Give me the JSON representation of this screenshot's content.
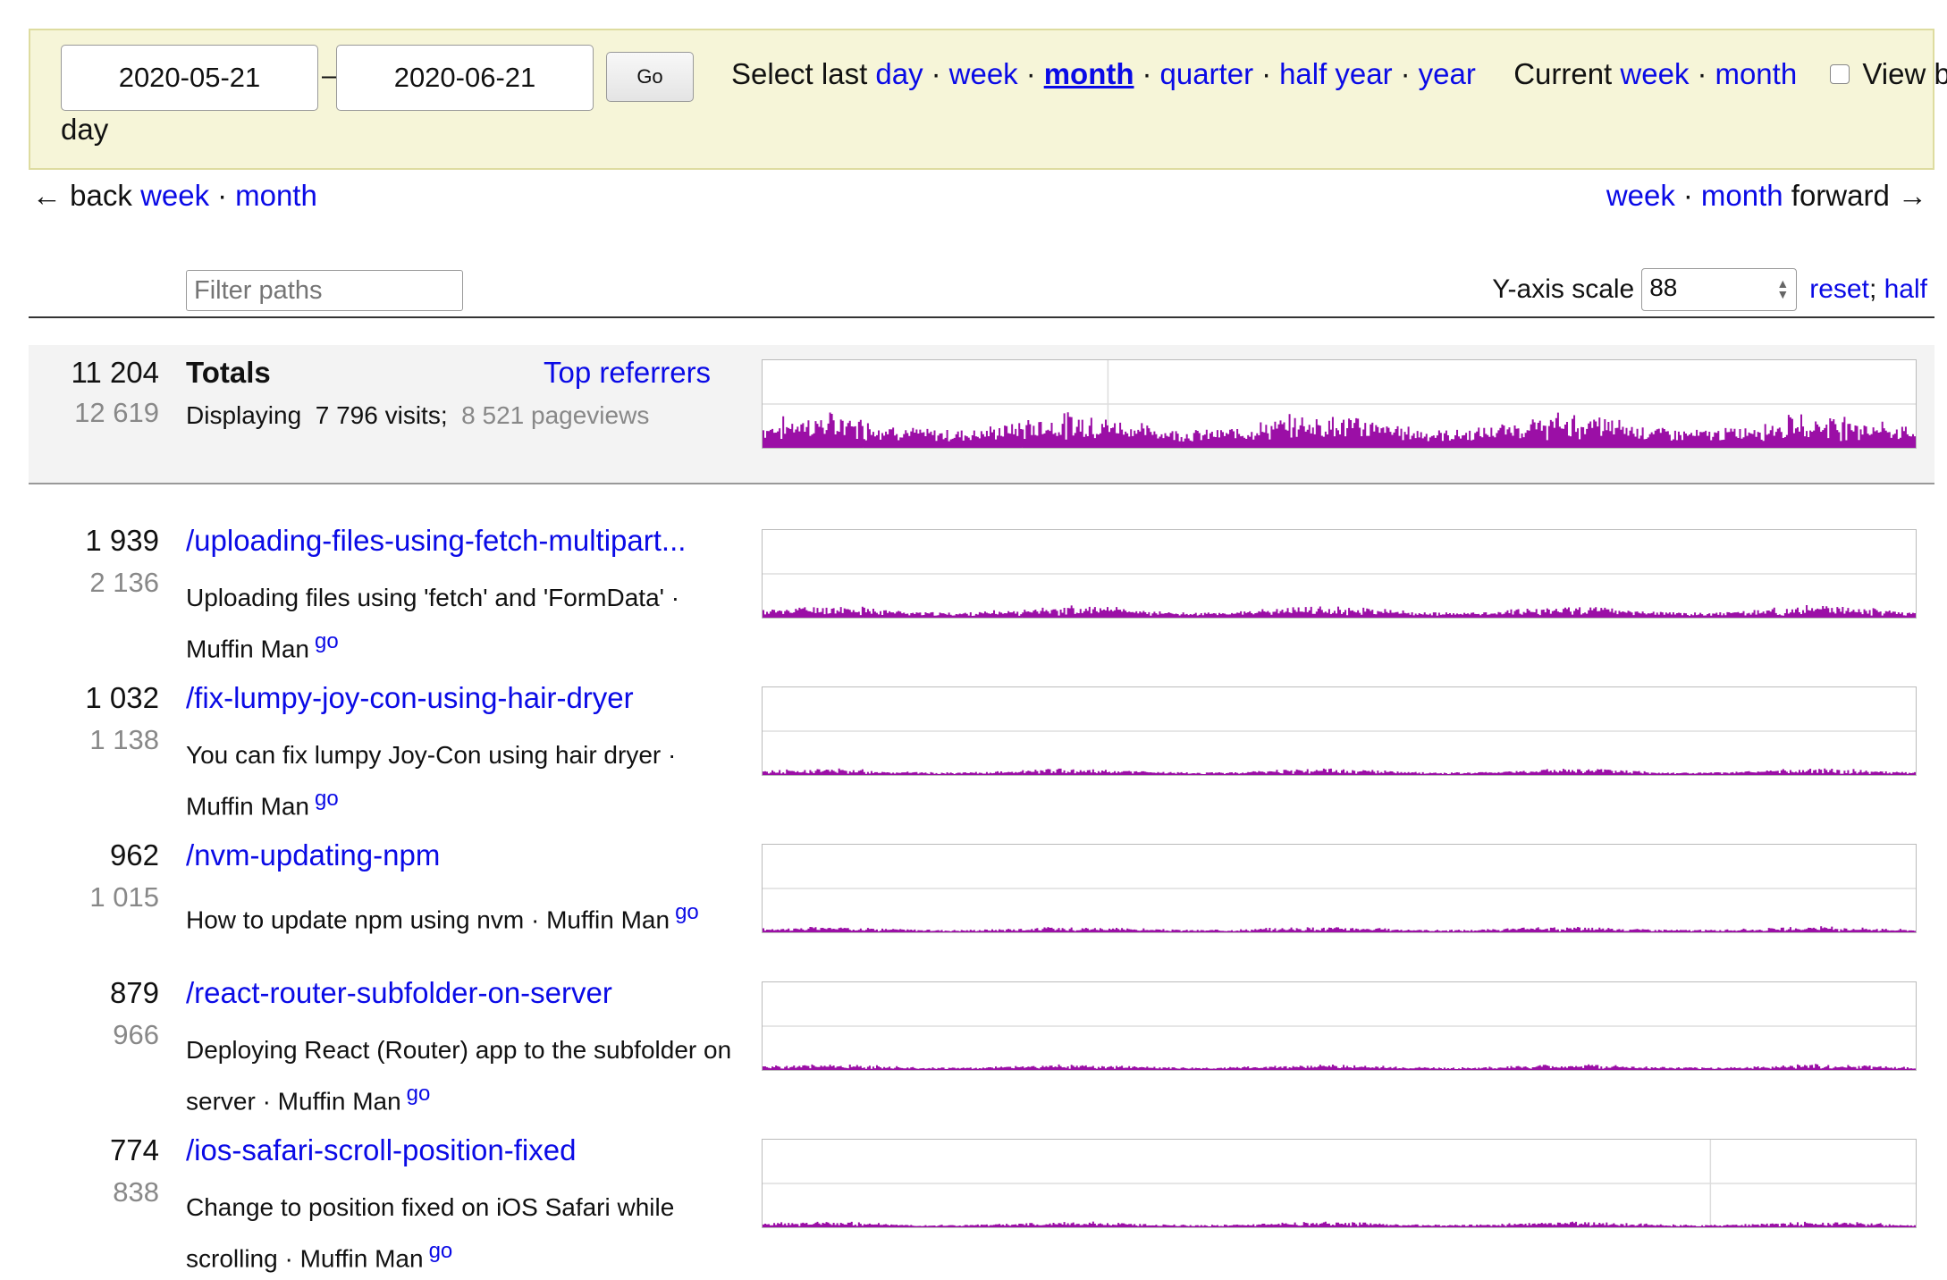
{
  "period": {
    "start": "2020-05-21",
    "dash": "–",
    "end": "2020-06-21",
    "go_label": "Go",
    "select_last_label": "Select last",
    "ranges": [
      "day",
      "week",
      "month",
      "quarter",
      "half year",
      "year"
    ],
    "active_range": "month",
    "current_label": "Current",
    "current_ranges": [
      "week",
      "month"
    ],
    "view_by_day_line1": "View by",
    "view_by_day_line2": "day",
    "view_by_day_checked": false
  },
  "nav": {
    "back_arrow": "←",
    "back_label": "back",
    "back_week": "week",
    "back_month": "month",
    "fwd_week": "week",
    "fwd_month": "month",
    "fwd_label": "forward",
    "fwd_arrow": "→",
    "sep": "·"
  },
  "filter": {
    "placeholder": "Filter paths"
  },
  "yaxis": {
    "label": "Y-axis scale",
    "value": "88",
    "reset": "reset",
    "semicolon": ";",
    "half": "half"
  },
  "totals": {
    "visits": "11 204",
    "pageviews": "12 619",
    "title": "Totals",
    "top_referrers": "Top referrers",
    "displaying_label": "Displaying",
    "displaying_visits": "7 796",
    "visits_label": "visits;",
    "displaying_pageviews": "8 521",
    "pageviews_label": "pageviews"
  },
  "pages": [
    {
      "visits": "1 939",
      "pageviews": "2 136",
      "path": "/uploading-files-using-fetch-multipart...",
      "desc": "Uploading files using 'fetch' and 'FormData' · Muffin Man",
      "go": "go"
    },
    {
      "visits": "1 032",
      "pageviews": "1 138",
      "path": "/fix-lumpy-joy-con-using-hair-dryer",
      "desc": "You can fix lumpy Joy-Con using hair dryer · Muffin Man",
      "go": "go"
    },
    {
      "visits": "962",
      "pageviews": "1 015",
      "path": "/nvm-updating-npm",
      "desc": "How to update npm using nvm · Muffin Man",
      "go": "go"
    },
    {
      "visits": "879",
      "pageviews": "966",
      "path": "/react-router-subfolder-on-server",
      "desc": "Deploying React (Router) app to the subfolder on server · Muffin Man",
      "go": "go"
    },
    {
      "visits": "774",
      "pageviews": "838",
      "path": "/ios-safari-scroll-position-fixed",
      "desc": "Change to position fixed on iOS Safari while scrolling · Muffin Man",
      "go": "go"
    }
  ],
  "colors": {
    "bar": "#9b0fa6",
    "link": "#0a0ae6",
    "highlight_bg": "#f6f5d8"
  }
}
